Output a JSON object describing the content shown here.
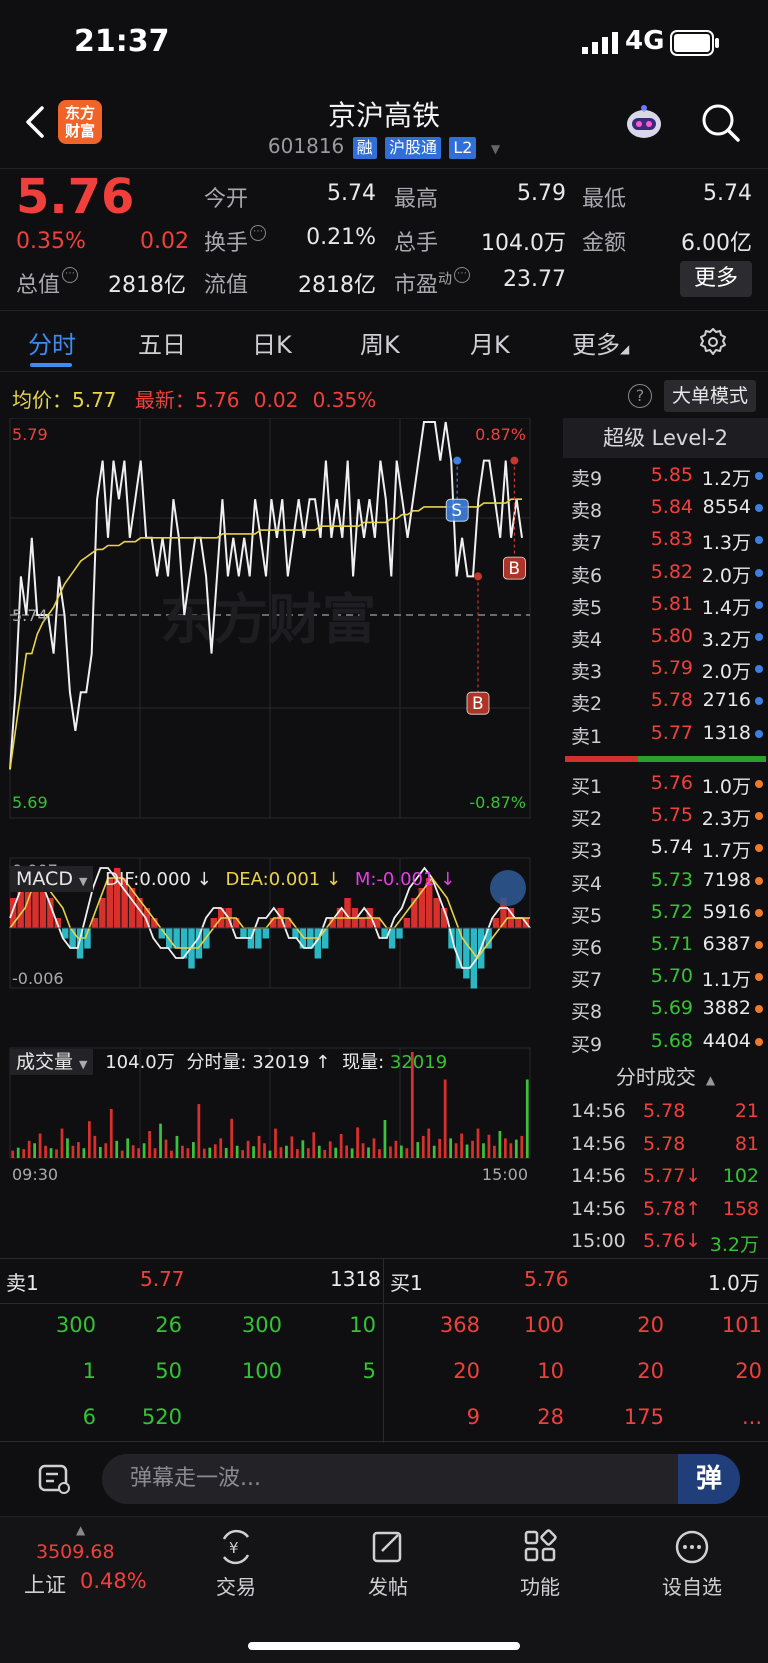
{
  "status_bar": {
    "time": "21:37",
    "network": "4G"
  },
  "header": {
    "title": "京沪高铁",
    "code": "601816",
    "tags": [
      "融",
      "沪股通",
      "L2"
    ],
    "logo_text": "东方财富"
  },
  "quote": {
    "price": "5.76",
    "change_pct": "0.35%",
    "change": "0.02",
    "fields": [
      {
        "label": "今开",
        "value": "5.74",
        "color": "#e8e8e8"
      },
      {
        "label": "最高",
        "value": "5.79",
        "color": "#f0403c"
      },
      {
        "label": "最低",
        "value": "5.74",
        "color": "#e8e8e8"
      },
      {
        "label": "换手",
        "value": "0.21%",
        "color": "#e8e8e8"
      },
      {
        "label": "总手",
        "value": "104.0万",
        "color": "#e8e8e8"
      },
      {
        "label": "金额",
        "value": "6.00亿",
        "color": "#e8e8e8"
      },
      {
        "label": "总值",
        "value": "2818亿",
        "color": "#e8e8e8"
      },
      {
        "label": "流值",
        "value": "2818亿",
        "color": "#e8e8e8"
      },
      {
        "label": "市盈",
        "value": "23.77",
        "color": "#e8e8e8"
      }
    ],
    "pe_superscript": "动",
    "more_label": "更多"
  },
  "tabs": [
    "分时",
    "五日",
    "日K",
    "周K",
    "月K",
    "更多"
  ],
  "infoline": {
    "avg_label": "均价：",
    "avg": "5.77",
    "last_label": "最新：",
    "last": "5.76",
    "chg": "0.02",
    "pct": "0.35%"
  },
  "big_mode_label": "大单模式",
  "watermark": "东方财富",
  "chart_data": [
    {
      "type": "line",
      "name": "分时",
      "y_top": "5.79",
      "y_ref": "5.74",
      "y_bottom": "5.69",
      "pct_top": "0.87%",
      "pct_bottom": "-0.87%",
      "ylim": [
        5.69,
        5.79
      ],
      "ref_close": 5.74,
      "price": [
        5.7,
        5.72,
        5.75,
        5.74,
        5.76,
        5.74,
        5.74,
        5.74,
        5.73,
        5.75,
        5.74,
        5.72,
        5.71,
        5.72,
        5.72,
        5.73,
        5.77,
        5.78,
        5.76,
        5.78,
        5.77,
        5.78,
        5.76,
        5.77,
        5.78,
        5.76,
        5.76,
        5.75,
        5.76,
        5.75,
        5.77,
        5.76,
        5.74,
        5.75,
        5.76,
        5.76,
        5.75,
        5.73,
        5.75,
        5.77,
        5.75,
        5.76,
        5.75,
        5.76,
        5.75,
        5.77,
        5.76,
        5.75,
        5.77,
        5.76,
        5.77,
        5.75,
        5.76,
        5.77,
        5.76,
        5.77,
        5.77,
        5.76,
        5.78,
        5.76,
        5.77,
        5.76,
        5.78,
        5.75,
        5.77,
        5.76,
        5.77,
        5.76,
        5.78,
        5.77,
        5.75,
        5.78,
        5.77,
        5.76,
        5.77,
        5.78,
        5.79,
        5.79,
        5.79,
        5.78,
        5.79,
        5.78,
        5.75,
        5.76,
        5.75,
        5.75,
        5.77,
        5.78,
        5.78,
        5.77,
        5.76,
        5.78,
        5.76,
        5.77,
        5.76
      ],
      "avg": [
        5.7,
        5.71,
        5.72,
        5.73,
        5.73,
        5.735,
        5.738,
        5.74,
        5.742,
        5.745,
        5.748,
        5.75,
        5.752,
        5.754,
        5.755,
        5.756,
        5.757,
        5.757,
        5.758,
        5.758,
        5.758,
        5.759,
        5.759,
        5.759,
        5.76,
        5.76,
        5.76,
        5.76,
        5.76,
        5.76,
        5.76,
        5.76,
        5.76,
        5.76,
        5.76,
        5.76,
        5.76,
        5.76,
        5.76,
        5.761,
        5.761,
        5.761,
        5.761,
        5.761,
        5.761,
        5.761,
        5.762,
        5.762,
        5.762,
        5.762,
        5.762,
        5.762,
        5.762,
        5.762,
        5.762,
        5.762,
        5.762,
        5.763,
        5.763,
        5.763,
        5.763,
        5.763,
        5.763,
        5.763,
        5.763,
        5.764,
        5.764,
        5.764,
        5.764,
        5.764,
        5.765,
        5.765,
        5.766,
        5.766,
        5.767,
        5.767,
        5.768,
        5.768,
        5.768,
        5.768,
        5.768,
        5.768,
        5.768,
        5.768,
        5.768,
        5.768,
        5.768,
        5.769,
        5.769,
        5.769,
        5.769,
        5.769,
        5.77,
        5.77,
        5.77
      ],
      "markers": [
        {
          "label": "S",
          "price": 5.77,
          "color": "#3d7fe0"
        },
        {
          "label": "B",
          "price": 5.72,
          "color": "#c0392b"
        },
        {
          "label": "B",
          "price": 5.755,
          "color": "#c0392b"
        }
      ],
      "x_start": "09:30",
      "x_end": "15:00"
    },
    {
      "type": "bar",
      "name": "MACD",
      "indicator_label": "MACD",
      "dif_label": "DIF:0.000 ↓",
      "dea_label": "DEA:0.001 ↓",
      "m_label": "M:-0.001 ↓",
      "y_top": "0.007",
      "y_bottom": "-0.006",
      "ylim": [
        -0.006,
        0.007
      ],
      "m": [
        0.003,
        0.004,
        0.004,
        0.005,
        0.004,
        0.003,
        0.001,
        -0.001,
        -0.002,
        -0.003,
        -0.002,
        0.001,
        0.003,
        0.005,
        0.006,
        0.005,
        0.004,
        0.003,
        0.002,
        0.001,
        -0.001,
        -0.002,
        -0.002,
        -0.003,
        -0.004,
        -0.003,
        -0.002,
        0.001,
        0.002,
        0.002,
        0.001,
        -0.001,
        -0.002,
        -0.002,
        -0.001,
        0.001,
        0.002,
        0.001,
        -0.001,
        -0.002,
        -0.002,
        -0.003,
        -0.002,
        0.001,
        0.002,
        0.003,
        0.002,
        0.001,
        0.002,
        0.001,
        -0.001,
        -0.002,
        -0.001,
        0.001,
        0.003,
        0.004,
        0.005,
        0.003,
        0.002,
        -0.002,
        -0.004,
        -0.005,
        -0.006,
        -0.004,
        -0.002,
        0.001,
        0.003,
        0.002,
        0.001,
        0.001
      ],
      "dif": [
        0.001,
        0.003,
        0.005,
        0.006,
        0.005,
        0.003,
        0.001,
        -0.001,
        -0.002,
        -0.002,
        0.001,
        0.004,
        0.006,
        0.006,
        0.005,
        0.004,
        0.003,
        0.002,
        0.001,
        -0.001,
        -0.002,
        -0.002,
        -0.003,
        -0.003,
        -0.002,
        -0.001,
        0.001,
        0.002,
        0.002,
        0.001,
        -0.001,
        -0.001,
        -0.001,
        0.001,
        0.001,
        0.002,
        0.001,
        -0.001,
        -0.001,
        -0.002,
        -0.002,
        -0.001,
        0.001,
        0.001,
        0.002,
        0.001,
        0.001,
        0.002,
        0.001,
        -0.001,
        -0.001,
        0.001,
        0.002,
        0.004,
        0.005,
        0.006,
        0.005,
        0.003,
        0.001,
        -0.002,
        -0.004,
        -0.004,
        -0.003,
        -0.001,
        0.001,
        0.002,
        0.002,
        0.001,
        0.001,
        0.0
      ],
      "dea": [
        0.0,
        0.001,
        0.002,
        0.004,
        0.005,
        0.004,
        0.003,
        0.002,
        0.0,
        -0.001,
        -0.001,
        0.001,
        0.003,
        0.005,
        0.005,
        0.005,
        0.004,
        0.003,
        0.002,
        0.001,
        0.0,
        -0.001,
        -0.002,
        -0.002,
        -0.002,
        -0.002,
        -0.001,
        0.0,
        0.001,
        0.001,
        0.001,
        0.0,
        0.0,
        0.0,
        0.0,
        0.001,
        0.001,
        0.001,
        0.0,
        -0.001,
        -0.001,
        -0.001,
        0.0,
        0.001,
        0.001,
        0.001,
        0.001,
        0.001,
        0.001,
        0.001,
        0.0,
        0.0,
        0.001,
        0.002,
        0.003,
        0.004,
        0.005,
        0.004,
        0.003,
        0.001,
        -0.001,
        -0.002,
        -0.003,
        -0.002,
        -0.001,
        0.0,
        0.001,
        0.001,
        0.001,
        0.001
      ]
    },
    {
      "type": "bar",
      "name": "成交量",
      "indicator_label": "成交量",
      "total_label": "104.0万",
      "minute_label": "分时量: 32019 ↑",
      "current_label": "现量:",
      "current_value": "32019",
      "y_top": "43232",
      "ylim": [
        0,
        43232
      ],
      "values": [
        3000,
        4200,
        3600,
        7000,
        6000,
        10000,
        5000,
        4000,
        3500,
        12000,
        8000,
        5000,
        6500,
        4000,
        15000,
        9000,
        4500,
        6000,
        20000,
        7000,
        3000,
        8000,
        5200,
        4000,
        6000,
        11000,
        4000,
        14000,
        7500,
        3000,
        9000,
        5000,
        4000,
        6500,
        22000,
        3800,
        4200,
        5600,
        8000,
        4100,
        16000,
        5000,
        3200,
        7000,
        4800,
        9000,
        6000,
        3000,
        12000,
        4400,
        5000,
        8800,
        3600,
        7200,
        4000,
        10500,
        5000,
        3300,
        6800,
        4200,
        9800,
        5100,
        3900,
        12500,
        6000,
        4300,
        8000,
        3600,
        15500,
        4700,
        7000,
        5100,
        4000,
        43232,
        6500,
        9000,
        12000,
        5000,
        7800,
        32000,
        8000,
        6000,
        10000,
        5500,
        7000,
        12000,
        6000,
        9500,
        5000,
        11000,
        8000,
        6000,
        7500,
        9000,
        32019
      ],
      "colors": [
        "r",
        "g",
        "r",
        "r",
        "g",
        "r",
        "r",
        "g",
        "r",
        "r",
        "g",
        "r",
        "r",
        "g",
        "r",
        "r",
        "g",
        "r",
        "r",
        "g",
        "r",
        "g",
        "r",
        "r",
        "g",
        "r",
        "r",
        "g",
        "r",
        "r",
        "g",
        "r",
        "r",
        "g",
        "r",
        "r",
        "g",
        "r",
        "r",
        "g",
        "r",
        "g",
        "r",
        "r",
        "g",
        "r",
        "r",
        "g",
        "r",
        "r",
        "g",
        "r",
        "r",
        "g",
        "r",
        "r",
        "g",
        "r",
        "r",
        "g",
        "r",
        "r",
        "g",
        "r",
        "r",
        "g",
        "r",
        "r",
        "g",
        "r",
        "r",
        "g",
        "r",
        "r",
        "g",
        "r",
        "r",
        "g",
        "r",
        "r",
        "g",
        "r",
        "r",
        "g",
        "r",
        "r",
        "g",
        "r",
        "r",
        "g",
        "r",
        "r",
        "g",
        "r",
        "g"
      ],
      "x_start": "09:30",
      "x_end": "15:00"
    }
  ],
  "order_book": {
    "title": "超级 Level-2",
    "asks": [
      {
        "level": "卖9",
        "price": "5.85",
        "vol": "1.2万",
        "pc": "#f0403c",
        "dot": "#3d7fe0"
      },
      {
        "level": "卖8",
        "price": "5.84",
        "vol": "8554",
        "pc": "#f0403c",
        "dot": "#3d7fe0"
      },
      {
        "level": "卖7",
        "price": "5.83",
        "vol": "1.3万",
        "pc": "#f0403c",
        "dot": "#3d7fe0"
      },
      {
        "level": "卖6",
        "price": "5.82",
        "vol": "2.0万",
        "pc": "#f0403c",
        "dot": "#3d7fe0"
      },
      {
        "level": "卖5",
        "price": "5.81",
        "vol": "1.4万",
        "pc": "#f0403c",
        "dot": "#3d7fe0"
      },
      {
        "level": "卖4",
        "price": "5.80",
        "vol": "3.2万",
        "pc": "#f0403c",
        "dot": "#3d7fe0"
      },
      {
        "level": "卖3",
        "price": "5.79",
        "vol": "2.0万",
        "pc": "#f0403c",
        "dot": "#3d7fe0"
      },
      {
        "level": "卖2",
        "price": "5.78",
        "vol": "2716",
        "pc": "#f0403c",
        "dot": "#3d7fe0"
      },
      {
        "level": "卖1",
        "price": "5.77",
        "vol": "1318",
        "pc": "#f0403c",
        "dot": "#3d7fe0"
      }
    ],
    "bids": [
      {
        "level": "买1",
        "price": "5.76",
        "vol": "1.0万",
        "pc": "#f0403c",
        "dot": "#f07a2a"
      },
      {
        "level": "买2",
        "price": "5.75",
        "vol": "2.3万",
        "pc": "#f0403c",
        "dot": "#f07a2a"
      },
      {
        "level": "买3",
        "price": "5.74",
        "vol": "1.7万",
        "pc": "#e8e8e8",
        "dot": "#f07a2a"
      },
      {
        "level": "买4",
        "price": "5.73",
        "vol": "7198",
        "pc": "#35c235",
        "dot": "#f07a2a"
      },
      {
        "level": "买5",
        "price": "5.72",
        "vol": "5916",
        "pc": "#35c235",
        "dot": "#f07a2a"
      },
      {
        "level": "买6",
        "price": "5.71",
        "vol": "6387",
        "pc": "#35c235",
        "dot": "#f07a2a"
      },
      {
        "level": "买7",
        "price": "5.70",
        "vol": "1.1万",
        "pc": "#35c235",
        "dot": "#f07a2a"
      },
      {
        "level": "买8",
        "price": "5.69",
        "vol": "3882",
        "pc": "#35c235",
        "dot": "#f07a2a"
      },
      {
        "level": "买9",
        "price": "5.68",
        "vol": "4404",
        "pc": "#35c235",
        "dot": "#f07a2a"
      }
    ],
    "ratio_sell": 0.36
  },
  "trades": {
    "title": "分时成交",
    "rows": [
      {
        "time": "14:56",
        "price": "5.78",
        "vol": "21",
        "pc": "#f0403c",
        "vc": "#f0403c"
      },
      {
        "time": "14:56",
        "price": "5.78",
        "vol": "81",
        "pc": "#f0403c",
        "vc": "#f0403c"
      },
      {
        "time": "14:56",
        "price": "5.77↓",
        "vol": "102",
        "pc": "#f0403c",
        "vc": "#35c235"
      },
      {
        "time": "14:56",
        "price": "5.78↑",
        "vol": "158",
        "pc": "#f0403c",
        "vc": "#f0403c"
      },
      {
        "time": "15:00",
        "price": "5.76↓",
        "vol": "3.2万",
        "pc": "#f0403c",
        "vc": "#35c235"
      }
    ]
  },
  "queue": {
    "sell_label": "卖1",
    "sell_price": "5.77",
    "sell_vol": "1318",
    "buy_label": "买1",
    "buy_price": "5.76",
    "buy_vol": "1.0万",
    "sell_orders": [
      "300",
      "26",
      "300",
      "10",
      "1",
      "50",
      "100",
      "5",
      "6",
      "520"
    ],
    "buy_orders": [
      "368",
      "100",
      "20",
      "101",
      "20",
      "10",
      "20",
      "20",
      "9",
      "28",
      "175",
      "..."
    ]
  },
  "comment": {
    "placeholder": "弹幕走一波...",
    "danmu": "弹"
  },
  "nav": {
    "index_value": "3509.68",
    "index_name": "上证",
    "index_pct": "0.48%",
    "items": [
      "交易",
      "发帖",
      "功能",
      "设自选"
    ]
  }
}
